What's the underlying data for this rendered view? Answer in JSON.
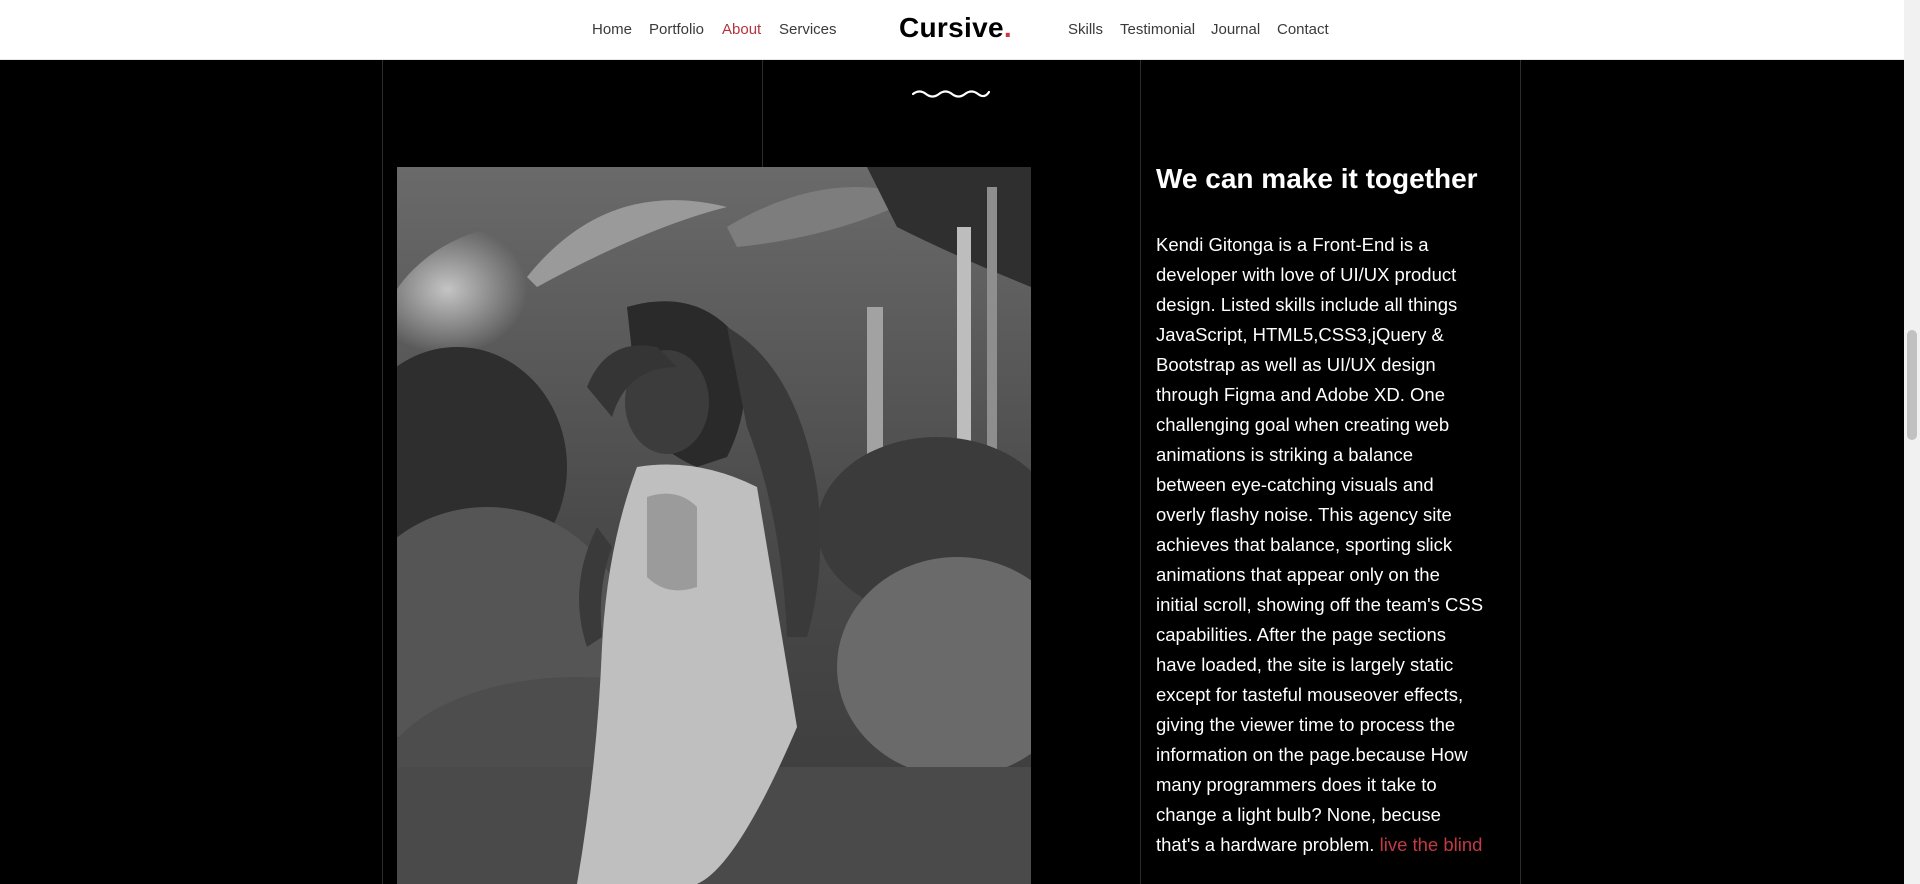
{
  "nav": {
    "left_items": [
      {
        "label": "Home",
        "active": false
      },
      {
        "label": "Portfolio",
        "active": false
      },
      {
        "label": "About",
        "active": true
      },
      {
        "label": "Services",
        "active": false
      }
    ],
    "brand": {
      "name": "Cursive",
      "dot": "."
    },
    "right_items": [
      {
        "label": "Skills",
        "active": false
      },
      {
        "label": "Testimonial",
        "active": false
      },
      {
        "label": "Journal",
        "active": false
      },
      {
        "label": "Contact",
        "active": false
      }
    ]
  },
  "about": {
    "heading": "We can make it together",
    "paragraph": "Kendi Gitonga is a Front-End is a developer with love of UI/UX product design. Listed skills include all things JavaScript, HTML5,CSS3,jQuery & Bootstrap as well as UI/UX design through Figma and Adobe XD. One challenging goal when creating web animations is striking a balance between eye-catching visuals and overly flashy noise. This agency site achieves that balance, sporting slick animations that appear only on the initial scroll, showing off the team's CSS capabilities. After the page sections have loaded, the site is largely static except for tasteful mouseover effects, giving the viewer time to process the information on the page.because How many programmers does it take to change a light bulb? None, becuse that's a hardware problem. ",
    "link_text": "live the blind"
  },
  "icons": {
    "divider": "wave-divider-icon",
    "photo": "portrait-photo"
  },
  "colors": {
    "accent": "#b4333d",
    "brand_dot": "#d6323f",
    "background": "#000000",
    "navbar": "#ffffff"
  }
}
